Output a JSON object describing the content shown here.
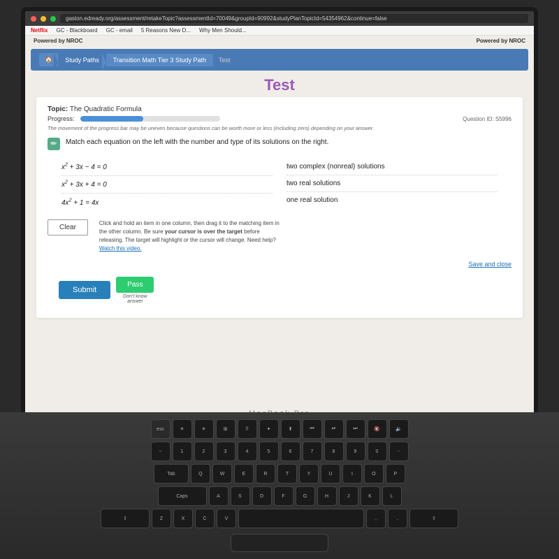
{
  "browser": {
    "url": "gaston.edready.org/assessment/retakeTopic?assessmentId=70049&groupId=90992&studyPlanTopicId=54354962&continue=false",
    "bookmarks": [
      {
        "label": "Netflix",
        "type": "netflix"
      },
      {
        "label": "GC - Blackboard",
        "type": "normal"
      },
      {
        "label": "GC - email",
        "type": "normal"
      },
      {
        "label": "5 Reasons New D...",
        "type": "normal"
      },
      {
        "label": "Why Men Should...",
        "type": "normal"
      }
    ]
  },
  "nroc": {
    "powered_by": "Powered by",
    "brand": "NROC"
  },
  "breadcrumb": {
    "home_icon": "🏠",
    "study_paths": "Study Paths",
    "tier": "Transition Math Tier 3 Study Path",
    "current": "Test"
  },
  "page_title": "Test",
  "topic": {
    "label": "Topic:",
    "value": "The Quadratic Formula"
  },
  "progress": {
    "label": "Progress:",
    "fill_percent": 45,
    "question_id": "Question ID: S5996"
  },
  "progress_note": "The movement of the progress bar may be uneven because questions can be worth more or less (including zero) depending on your answer.",
  "question": {
    "instruction": "Match each equation on the left with the number and type of its solutions on the right.",
    "equations": [
      "x² + 3x − 4 = 0",
      "x² + 3x + 4 = 0",
      "4x² + 1 = 4x"
    ],
    "solutions": [
      "two complex (nonreal) solutions",
      "two real solutions",
      "one real solution"
    ]
  },
  "clear_button": "Clear",
  "drag_instructions": {
    "text1": "Click and hold an item in one column, then drag it to the matching item in the other column. Be sure ",
    "bold": "your cursor is over the target",
    "text2": " before releasing. The target will highlight or the cursor will change. Need help?",
    "link": "Watch this video."
  },
  "save_close": "Save and close",
  "submit_button": "Submit",
  "pass_button": "Pass",
  "dont_know": "Don't know\nanswer",
  "macbook": "MacBook Pro",
  "keyboard": {
    "row1": [
      "esc",
      "F1",
      "F2",
      "F3",
      "F4",
      "F5",
      "F6",
      "F7",
      "F8",
      "F9",
      "F10",
      "F11"
    ],
    "row2": [
      "~",
      "1",
      "2",
      "3",
      "4",
      "5",
      "6",
      "7",
      "8",
      "9",
      "0",
      "-"
    ],
    "row3": [
      "Tab",
      "Q",
      "W",
      "E",
      "R",
      "T",
      "Y",
      "U",
      "I",
      "O",
      "P"
    ],
    "row4": [
      "Caps",
      "A",
      "S",
      "D",
      "F",
      "G",
      "H",
      "J",
      "K",
      "L"
    ]
  }
}
